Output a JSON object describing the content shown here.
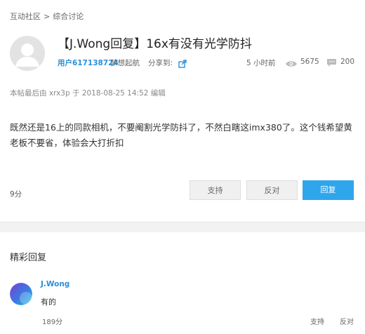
{
  "breadcrumb": {
    "items": [
      "互动社区",
      "综合讨论"
    ],
    "separator": ">"
  },
  "post": {
    "title": "【J.Wong回复】16x有没有光学防抖",
    "author": "用户617138724",
    "signature": "梦想起航",
    "share_label": "分享到:",
    "time": "5 小时前",
    "views": "5675",
    "comments": "200",
    "edit_note": "本帖最后由 xrx3p 于 2018-08-25 14:52 编辑",
    "content": "既然还是16上的同款相机，不要阉割光学防抖了，不然白瞎这imx380了。这个钱希望黄老板不要省，体验会大打折扣",
    "score": "9分",
    "buttons": {
      "support": "支持",
      "oppose": "反对",
      "reply": "回复"
    }
  },
  "replies": {
    "heading": "精彩回复",
    "items": [
      {
        "user": "J.Wong",
        "text": "有的",
        "score": "189分",
        "support": "支持",
        "oppose": "反对"
      }
    ]
  },
  "icons": [
    "share-icon",
    "eye-icon",
    "comment-icon",
    "avatar-placeholder-icon"
  ],
  "colors": {
    "accent": "#2fa6ec",
    "link": "#2a8fd8"
  }
}
